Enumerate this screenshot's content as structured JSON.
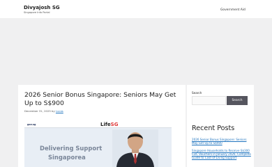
{
  "header": {
    "title": "Divyajosh SG",
    "description": "Singapore Info Portal",
    "nav": [
      {
        "label": "Government Aid"
      }
    ]
  },
  "post": {
    "title": "2026 Senior Bonus Singapore: Seniors May Get Up to S$900",
    "date": "December 31, 2025",
    "by": "by",
    "author": "Lucas",
    "image": {
      "logo_text": "gov.sg",
      "life_text": "Life",
      "life_suffix": "SG",
      "line1": "Delivering Support",
      "line2": "Singaporea"
    }
  },
  "sidebar": {
    "search_label": "Search",
    "search_value": "",
    "search_button": "Search",
    "recent_title": "Recent Posts",
    "recent_posts": [
      {
        "label": "2026 Senior Bonus Singapore: Seniors May Get Up to S$900"
      },
      {
        "label": "Singapore Households to Receive S$300 CDC Vouchers in January 2026, Complete Guide to Cost-of-Living Support"
      }
    ]
  },
  "colors": {
    "link": "#1e73be",
    "background": "#f0f0f1",
    "button": "#55555e"
  }
}
